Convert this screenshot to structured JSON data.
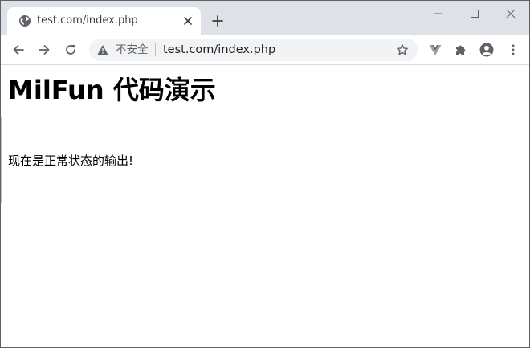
{
  "browser": {
    "tab": {
      "title": "test.com/index.php",
      "favicon": "globe-icon"
    },
    "window_controls": [
      "minimize-icon",
      "maximize-icon",
      "close-icon"
    ],
    "toolbar": {
      "nav": [
        "back-arrow-icon",
        "forward-arrow-icon",
        "reload-icon"
      ],
      "omnibox": {
        "security_icon": "warning-triangle-icon",
        "security_text": "不安全",
        "url": "test.com/index.php",
        "bookmark_icon": "star-outline-icon"
      },
      "extensions": [
        "vue-devtools-icon",
        "puzzle-icon",
        "profile-icon",
        "kebab-menu-icon"
      ]
    },
    "colors": {
      "tabstrip": "#dee1e6",
      "omnibox": "#f1f3f4",
      "icon": "#5f6368",
      "accent_mark": "#f2c744"
    }
  },
  "page": {
    "heading": "MilFun 代码演示",
    "message": "现在是正常状态的输出!"
  }
}
